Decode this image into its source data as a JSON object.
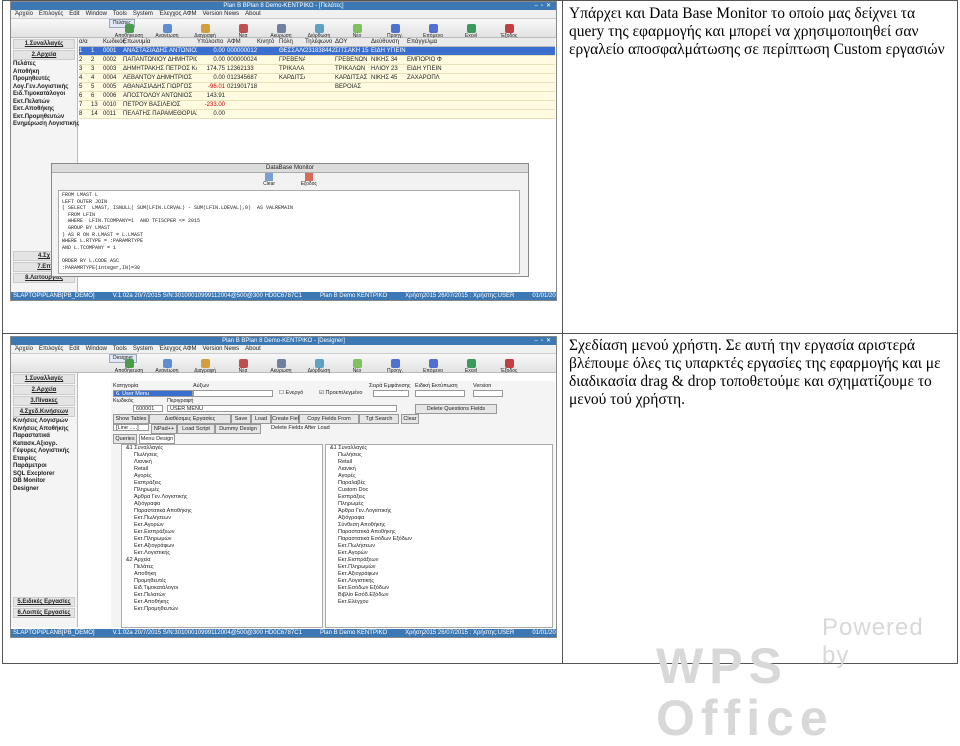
{
  "row1": {
    "text": "Υπάρχει και Data Base Monitor το οποίο μας δείχνει τα query της εφαρμογής και μπορεί να χρησιμοποιηθεί σαν εργαλείο αποσφαλμάτωσης σε περίπτωση Custom εργασιών",
    "shot": {
      "title": "Plan B BPlan 8 Demo-ΚΕΝΤΡΙΚΟ - [Πελάτες]",
      "menu": [
        "Ὰρχείο",
        "Επιλογές",
        "Edit",
        "Window",
        "Tools",
        "System",
        "Έλεγχος ΑΦΜ",
        "Version News",
        "About"
      ],
      "tab": "Πελάτες",
      "toolbar": [
        "Αποθήκευση",
        "Ανανέωση",
        "Διαγραφή",
        "Νέα",
        "Ακύρωση",
        "Διόρθωση",
        "Νέο",
        "Προηγ.",
        "Επόμενο",
        "Excel",
        "Έξοδος"
      ],
      "sidebar_sections": [
        "1.Συναλλαγές",
        "2.Αρχεία"
      ],
      "sidebar_items": [
        "Πελάτες",
        "Αποθήκη",
        "Προμηθευτές",
        "Λογ.Γεν.Λογιστικής",
        "Ειδ.Τιμοκατάλογοι",
        "Εκτ.Πελατών",
        "Εκτ.Αποθήκης",
        "Εκτ.Προμηθευτών",
        "Ενημέρωση Λογιστικής"
      ],
      "sidebar_bottom": [
        "4.Σχ",
        "7.Επ",
        "8.Λειτουργίες"
      ],
      "grid_headers": [
        "α/α",
        "Κωδικός",
        "Επωνυμία",
        "Υπόλοιπο",
        "ΑΦΜ",
        "Κινητό",
        "Πόλη",
        "Τηλέφωνο",
        "ΔΟΥ",
        "Διεύθυνση",
        "Επάγγελμα"
      ],
      "grid_rows": [
        [
          "1",
          "1",
          "0001",
          "ΑΝΑΣΤΑΣΙΑΔΗΣ ΑΝΤΩΝΙΟΣ",
          "0.00",
          "000000012",
          "",
          "ΘΕΣΣΑΛΟΝΙΚ",
          "2318384422",
          "ΣΙΤΣΑΚΗ 15",
          "ΕΙΔΗ ΥΓΙΕΙΝ"
        ],
        [
          "2",
          "2",
          "0002",
          "ΠΑΠΑΝΤΩΝΙΟΥ ΔΗΜΗΤΡΙΟΣ",
          "0.00",
          "000000024",
          "",
          "ΓΡΕΒΕΝΑ",
          "",
          "ΓΡΕΒΕΝΩΝ",
          "ΝΙΚΗΣ 34",
          "ΕΜΠΟΡΙΟ Φ"
        ],
        [
          "3",
          "3",
          "0003",
          "ΔΗΜΗΤΡΑΚΗΣ ΠΕΤΡΟΣ ΚΑΙ ΣΙΑ ΜΟΝΟΠΡΟΣΩ",
          "174.75",
          "12362133",
          "",
          "ΤΡΙΚΑΛΑ",
          "",
          "ΤΡΙΚΑΛΩΝ",
          "ΗΛΙΟΥ 23",
          "ΕΙΔΗ ΥΓΙΕΙΝ"
        ],
        [
          "4",
          "4",
          "0004",
          "ΛΕΒΑΝΤΟΥ ΔΗΜΗΤΡΙΟΣ",
          "0.00",
          "012345687",
          "",
          "ΚΑΡΔΙΤΣΑ",
          "",
          "ΚΑΡΔΙΤΣΑΣ",
          "ΝΙΚΗΣ 45",
          "ΖΑΧΑΡΟΠΛ"
        ],
        [
          "5",
          "5",
          "0005",
          "ΑΘΑΝΑΣΙΑΔΗΣ ΓΙΩΡΓΟΣ",
          "-96.01",
          "021901718",
          "",
          "",
          "",
          "ΒΕΡΟΙΑΣ",
          "",
          ""
        ],
        [
          "6",
          "6",
          "0006",
          "ΑΠΟΣΤΟΛΟΥ ΑΝΤΩΝΙΟΣ",
          "143.91",
          "",
          "",
          "",
          "",
          "",
          "",
          ""
        ],
        [
          "7",
          "13",
          "0010",
          "ΠΕΤΡΟΥ ΒΑΣΙΛΕΙΟΣ",
          "-233.00",
          "",
          "",
          "",
          "",
          "",
          "",
          ""
        ],
        [
          "8",
          "14",
          "0011",
          "ΠΕΛΑΤΗΣ ΠΑΡΑΜΕΘΟΡΙΑΣ ΠΕΡΙΟΧΗΣ",
          "0.00",
          "",
          "",
          "",
          "",
          "",
          "",
          ""
        ]
      ],
      "dialog_title": "DataBase Monitor",
      "dialog_clear": "Clear",
      "dialog_exit": "Εξοδος",
      "sql": "FROM LMAST L\nLEFT OUTER JOIN\n( SELECT  LMAST, ISNULL( SUM(LFIN.LCRVAL) - SUM(LFIN.LDEVAL),0)  AS VALREMAIN\n  FROM LFIN\n  WHERE  LFIN.TCOMPANY=1  AND TFISCPER <= 2015\n  GROUP BY LMAST\n) AS R ON R.LMAST = L.LMAST\nWHERE L.RTYPE = :PARAMRTYPE\nAND L.TCOMPANY = 1\n\nORDER BY L.CODE ASC\n:PARAMRTYPE(integer,IN)=30",
      "status": [
        "SLAPTOP\\PLANB[PB_DEMO]",
        "V.1.02a 20/7/2015 S/N:30100010999112004@500@300 HD0C6787C1",
        "Plan B Demo ΚΕΝΤΡΙΚΟ",
        "Χρήση2015 26/07/2015 : Χρήστης:USER",
        "01/01/2015 00:00 - 31/12/2015 23:59"
      ]
    }
  },
  "row2": {
    "text": "Σχεδίαση μενού χρήστη. Σε αυτή την εργασία αριστερά βλέπουμε όλες τις υπαρκτές εργασίες της εφαρμογής και με διαδικασία drag & drop τοποθετούμε και σχηματίζουμε το μενού τού χρήστη.",
    "shot": {
      "title": "Plan B BPlan 8 Demo-ΚΕΝΤΡΙΚΟ - [Designer]",
      "menu": [
        "Ὰρχείο",
        "Επιλογές",
        "Edit",
        "Window",
        "Tools",
        "System",
        "Έλεγχος ΑΦΜ",
        "Version News",
        "About"
      ],
      "tab": "Designer",
      "toolbar": [
        "Αποθήκευση",
        "Ανανέωση",
        "Διαγραφή",
        "Νέα",
        "Ακύρωση",
        "Διόρθωση",
        "Νέο",
        "Προηγ.",
        "Επόμενο",
        "Excel",
        "Έξοδος"
      ],
      "sidebar_sections": [
        "1.Συναλλαγές",
        "2.Αρχεία",
        "3.Πίνακες",
        "4.Σχεδ.Κινήσεων"
      ],
      "sidebar_items": [
        "Κινήσεις Λογισμών",
        "Κινήσεις Αποθήκης",
        "Παραστατικά",
        "Κατασκ.Αξιογρ.",
        "Γέφυρες Λογιστικής",
        "Εταιρίες",
        "Παράμετροι",
        "SQL Excplorer",
        "DB Monitor",
        "Designer"
      ],
      "sidebar_bottom": [
        "5.Ειδικές Εργασίες",
        "6.Λοιπές Εργασίες"
      ],
      "form": {
        "category_label": "Κατηγορία",
        "category_value": "6. User Menu",
        "order_label": "Αύξων",
        "active_label": "Ενεργό",
        "default_label": "Προεπιλεγμένο",
        "sort_label": "Σειρά Εμφάνισης",
        "print_label": "Ειδική Εκτύπωση",
        "version_label": "Version",
        "code_label": "Κωδικός",
        "code_value": "600001",
        "desc_label": "Περιγραφή",
        "desc_value": "USER MENU",
        "delete_label": "Delete Questions Fields",
        "buttons": [
          "Show Tables",
          "Διαθέσιμες Εργασίες",
          "Save",
          "Load",
          "Create Fields",
          "Copy Fields From",
          "Tgt Search",
          "Clear"
        ],
        "row3": [
          "[Line .....]",
          "NPad++",
          "Load Script",
          "Dummy Design",
          "Delete Fields After Load"
        ],
        "tabs": [
          "Queries",
          "Menu Design"
        ]
      },
      "left_tree": [
        "&1 Συναλλαγές",
        "Πωλήσεις",
        "Λιανική",
        "Retail",
        "Αγορές",
        "Εισπράξεις",
        "Πληρωμές",
        "Άρθρα Γεν.Λογιστικής",
        "Αξιόγραφα",
        "Παραστατικά Αποθήκης",
        "Εκτ.Πωλήσεων",
        "Εκτ.Αγορών",
        "Εκτ.Εισπράξεων",
        "Εκτ.Πληρωμών",
        "Εκτ.Αξιογράφων",
        "Εκτ.Λογιστικής",
        "&2 Αρχεία",
        "Πελάτες",
        "Αποθήκη",
        "Προμηθευτές",
        "Ειδ.Τιμοκατάλογοι",
        "Εκτ.Πελατών",
        "Εκτ.Αποθήκης",
        "Εκτ.Προμηθευτών"
      ],
      "right_tree": [
        "&1 Συναλλαγές",
        "Πωλήσεις",
        "Retail",
        "Λιανική",
        "Αγορές",
        "Παραλαβές",
        "Custom Doc",
        "Εισπράξεις",
        "Πληρωμές",
        "Άρθρα Γεν.Λογιστικής",
        "Αξιόγραφα",
        "Σύνθεση Αποθήκης",
        "Παραστατικά Αποθήκης",
        "Παραστατικά Εσόδων Εξόδων",
        "Εκτ.Πωλήσεων",
        "Εκτ.Αγορών",
        "Εκτ.Εισπράξεων",
        "Εκτ.Πληρωμών",
        "Εκτ.Αξιογράφων",
        "Εκτ.Λογιστικής",
        "Εκτ.Εσόδων Εξόδων",
        "Βιβλίο Εσόδ.Εξόδων",
        "Εκτ.Ελέγχου"
      ],
      "status": [
        "SLAPTOP\\PLANB[PB_DEMO]",
        "V.1.02a 20/7/2015 S/N:30100010999112004@500@300 HD0C6787C1",
        "Plan B Demo ΚΕΝΤΡΙΚΟ",
        "Χρήση2015 26/07/2015 : Χρήστης:USER",
        "01/01/2015 00:00 - 31/12/2015 23:59"
      ]
    }
  },
  "watermark": {
    "line1": "Powered by",
    "line2": "WPS Office"
  }
}
